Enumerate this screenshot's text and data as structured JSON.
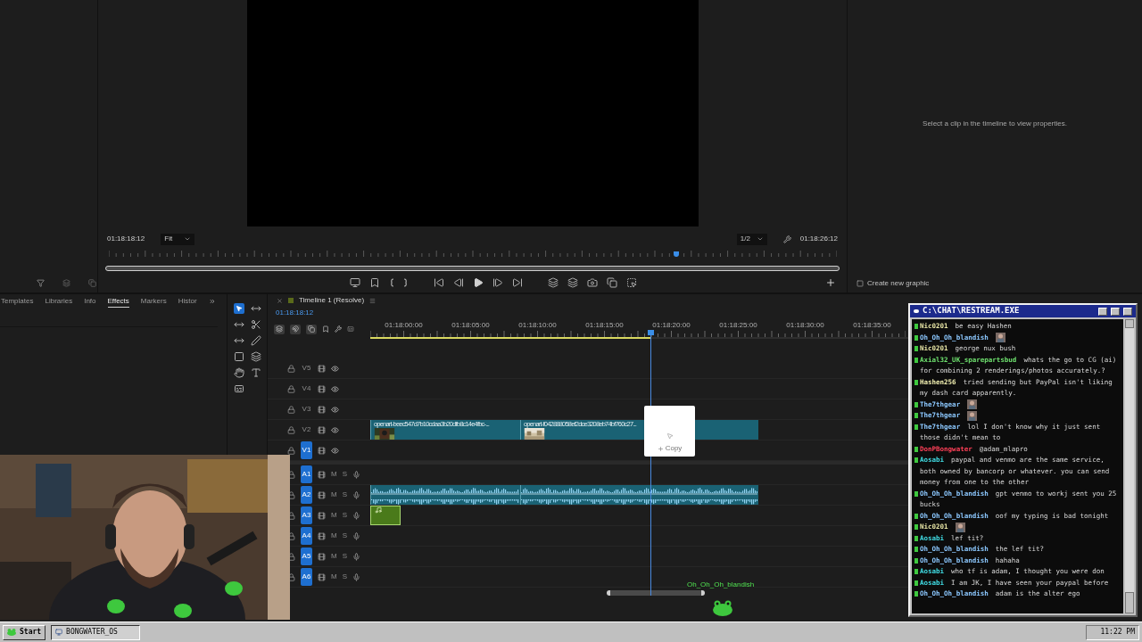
{
  "monitor": {
    "in_timecode": "01:18:18:12",
    "zoom": "Fit",
    "resolution": "1/2",
    "out_timecode": "01:18:26:12",
    "playhead": {
      "level": 0.78
    }
  },
  "properties": {
    "message": "Select a clip in the timeline to view properties.",
    "create_button": "Create new graphic"
  },
  "panel_tabs": [
    {
      "label": "Templates",
      "selected": false
    },
    {
      "label": "Libraries",
      "selected": false
    },
    {
      "label": "Info",
      "selected": false
    },
    {
      "label": "Effects",
      "selected": true
    },
    {
      "label": "Markers",
      "selected": false
    },
    {
      "label": "Histor",
      "selected": false
    }
  ],
  "timeline": {
    "tab_title": "Timeline 1 (Resolve)",
    "timecode": "01:18:18:12",
    "ruler": [
      "01:18:00:00",
      "01:18:05:00",
      "01:18:10:00",
      "01:18:15:00",
      "01:18:20:00",
      "01:18:25:00",
      "01:18:30:00",
      "01:18:35:00"
    ],
    "playhead": {
      "level": 0.52
    },
    "tracks": [
      {
        "label": "V5",
        "kind": "video",
        "targeted": false
      },
      {
        "label": "V4",
        "kind": "video",
        "targeted": false
      },
      {
        "label": "V3",
        "kind": "video",
        "targeted": false
      },
      {
        "label": "V2",
        "kind": "video",
        "targeted": false,
        "clips": [
          {
            "kind": "video",
            "name": "openart-beec547d7b10cdaa3b20dfb8c14e4fbc-..."
          },
          {
            "kind": "video",
            "name": "openart-f042888058ef2dce3208eb74bf760c27..."
          }
        ]
      },
      {
        "label": "V1",
        "kind": "video",
        "targeted": true
      },
      {
        "label": "A1",
        "kind": "audio",
        "targeted": true,
        "mute": "M",
        "solo": "S"
      },
      {
        "label": "A2",
        "kind": "audio",
        "targeted": true,
        "mute": "M",
        "solo": "S",
        "clips": [
          {
            "kind": "audio"
          },
          {
            "kind": "audio"
          }
        ]
      },
      {
        "label": "A3",
        "kind": "audio",
        "targeted": true,
        "mute": "M",
        "solo": "S",
        "clips": [
          {
            "kind": "music"
          }
        ]
      },
      {
        "label": "A4",
        "kind": "audio",
        "targeted": true,
        "mute": "M",
        "solo": "S"
      },
      {
        "label": "A5",
        "kind": "audio",
        "targeted": true,
        "mute": "M",
        "solo": "S"
      },
      {
        "label": "A6",
        "kind": "audio",
        "targeted": true,
        "mute": "M",
        "solo": "S"
      }
    ]
  },
  "drag_tooltip": {
    "label": "Copy"
  },
  "alert": {
    "name": "Oh_Oh_Oh_blandish"
  },
  "chat": {
    "title": "C:\\CHAT\\RESTREAM.EXE",
    "messages": [
      {
        "kind": "text",
        "user": "Nic0201",
        "color": "#e8e6a6",
        "text": "be easy Hashen"
      },
      {
        "kind": "emote",
        "user": "Oh_Oh_Oh_blandish",
        "color": "#8cc8ff"
      },
      {
        "kind": "text",
        "user": "Nic0201",
        "color": "#e8e6a6",
        "text": "george nux bush"
      },
      {
        "kind": "text",
        "user": "Axial32_UK_sparepartsbud",
        "color": "#6ee06e",
        "text": "whats the go to CG (ai) for combining 2 renderings/photos accurately.?"
      },
      {
        "kind": "text",
        "user": "Hashen256",
        "color": "#f0eeb0",
        "text": "tried sending but PayPal isn't liking my dash card apparently."
      },
      {
        "kind": "emote",
        "user": "The7thgear",
        "color": "#8cc8ff"
      },
      {
        "kind": "emote",
        "user": "The7thgear",
        "color": "#8cc8ff"
      },
      {
        "kind": "text",
        "user": "The7thgear",
        "color": "#8cc8ff",
        "text": "lol I don't know why it just sent those didn't mean to"
      },
      {
        "kind": "text",
        "user": "DonPBongwater",
        "color": "#ff4058",
        "text": "@adam_mlapro"
      },
      {
        "kind": "text",
        "user": "Aosabi",
        "color": "#40dce4",
        "text": "paypal and venmo are the same service, both owned by bancorp or whatever. you can send money from one to the other"
      },
      {
        "kind": "text",
        "user": "Oh_Oh_Oh_blandish",
        "color": "#8cc8ff",
        "text": "gpt venmo to workj sent you 25 bucks"
      },
      {
        "kind": "text",
        "user": "Oh_Oh_Oh_blandish",
        "color": "#8cc8ff",
        "text": "oof my typing is bad tonight"
      },
      {
        "kind": "emote",
        "user": "Nic0201",
        "color": "#e8e6a6"
      },
      {
        "kind": "text",
        "user": "Aosabi",
        "color": "#40dce4",
        "text": "lef tit?"
      },
      {
        "kind": "text",
        "user": "Oh_Oh_Oh_blandish",
        "color": "#8cc8ff",
        "text": "the lef tit?"
      },
      {
        "kind": "text",
        "user": "Oh_Oh_Oh_blandish",
        "color": "#8cc8ff",
        "text": "hahaha"
      },
      {
        "kind": "text",
        "user": "Aosabi",
        "color": "#40dce4",
        "text": "who tf is adam, I thought you were don"
      },
      {
        "kind": "text",
        "user": "Aosabi",
        "color": "#40dce4",
        "text": "I am JK, I have seen your paypal before"
      },
      {
        "kind": "text",
        "user": "Oh_Oh_Oh_blandish",
        "color": "#8cc8ff",
        "text": "adam is the alter ego"
      }
    ]
  },
  "taskbar": {
    "start": "Start",
    "tasks": [
      {
        "label": "BONGWATER_OS"
      }
    ],
    "clock": "11:22 PM"
  }
}
